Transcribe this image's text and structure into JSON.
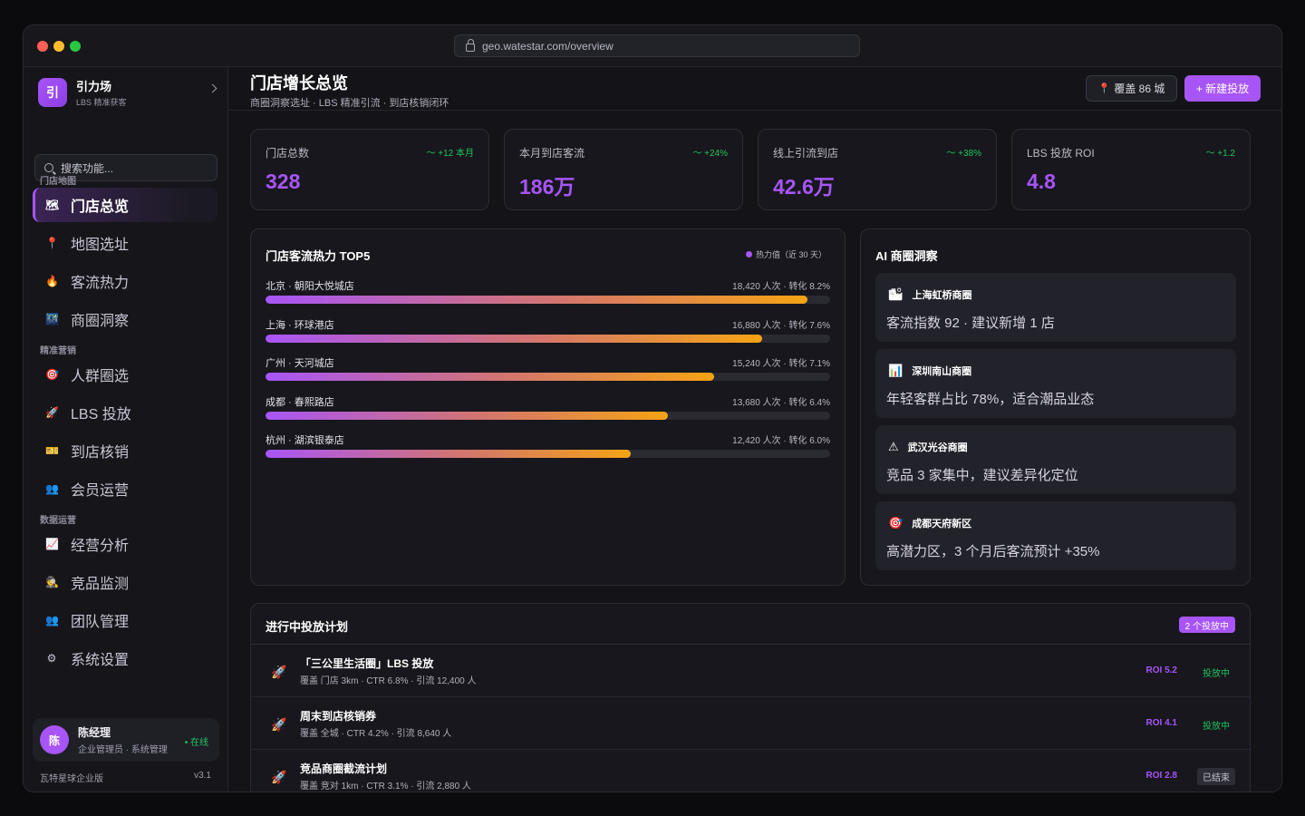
{
  "browser": {
    "url": "geo.watestar.com/overview"
  },
  "sidebar": {
    "brand": {
      "logo": "引",
      "name": "引力场",
      "subtitle": "LBS 精准获客"
    },
    "search_placeholder": "搜索功能...",
    "sections": [
      {
        "label": "门店地图",
        "items": [
          {
            "icon": "🗺",
            "label": "门店总览",
            "active": true
          },
          {
            "icon": "📍",
            "label": "地图选址"
          },
          {
            "icon": "🔥",
            "label": "客流热力"
          },
          {
            "icon": "🌃",
            "label": "商圈洞察"
          }
        ]
      },
      {
        "label": "精准营销",
        "items": [
          {
            "icon": "🎯",
            "label": "人群圈选"
          },
          {
            "icon": "🚀",
            "label": "LBS 投放"
          },
          {
            "icon": "🎫",
            "label": "到店核销"
          },
          {
            "icon": "👥",
            "label": "会员运营"
          }
        ]
      },
      {
        "label": "数据运营",
        "items": [
          {
            "icon": "📈",
            "label": "经营分析"
          },
          {
            "icon": "🕵",
            "label": "竞品监测"
          },
          {
            "icon": "👥",
            "label": "团队管理"
          },
          {
            "icon": "⚙",
            "label": "系统设置"
          }
        ]
      }
    ],
    "user": {
      "avatar": "陈",
      "name": "陈经理",
      "role": "企业管理员 · 系统管理",
      "status": "• 在线"
    },
    "footer": {
      "edition": "瓦特星球企业版",
      "version": "v3.1"
    }
  },
  "header": {
    "title": "门店增长总览",
    "subtitle": "商圈洞察选址 · LBS 精准引流 · 到店核销闭环",
    "cover_label": "覆盖 86 城",
    "new_button": "+ 新建投放"
  },
  "kpis": [
    {
      "label": "门店总数",
      "delta": "+12 本月",
      "value": "328"
    },
    {
      "label": "本月到店客流",
      "delta": "+24%",
      "value": "186万"
    },
    {
      "label": "线上引流到店",
      "delta": "+38%",
      "value": "42.6万"
    },
    {
      "label": "LBS 投放 ROI",
      "delta": "+1.2",
      "value": "4.8"
    }
  ],
  "heat": {
    "title": "门店客流热力 TOP5",
    "legend": "热力值（近 30 天）",
    "colors": {
      "start": "#a855f7",
      "end": "#f5a314"
    },
    "rows": [
      {
        "name": "北京 · 朝阳大悦城店",
        "meta": "18,420 人次 · 转化 8.2%",
        "visitors": 18420
      },
      {
        "name": "上海 · 环球港店",
        "meta": "16,880 人次 · 转化 7.6%",
        "visitors": 16880
      },
      {
        "name": "广州 · 天河城店",
        "meta": "15,240 人次 · 转化 7.1%",
        "visitors": 15240
      },
      {
        "name": "成都 · 春熙路店",
        "meta": "13,680 人次 · 转化 6.4%",
        "visitors": 13680
      },
      {
        "name": "杭州 · 湖滨银泰店",
        "meta": "12,420 人次 · 转化 6.0%",
        "visitors": 12420
      }
    ],
    "scale_max": 19200
  },
  "ai": {
    "title": "AI 商圈洞察",
    "items": [
      {
        "icon": "🏙",
        "name": "上海虹桥商圈",
        "text": "客流指数 92 · 建议新增 1 店"
      },
      {
        "icon": "📊",
        "name": "深圳南山商圈",
        "text": "年轻客群占比 78%，适合潮品业态"
      },
      {
        "icon": "⚠",
        "name": "武汉光谷商圈",
        "text": "竞品 3 家集中，建议差异化定位"
      },
      {
        "icon": "🎯",
        "name": "成都天府新区",
        "text": "高潜力区，3 个月后客流预计 +35%"
      }
    ]
  },
  "plans": {
    "title": "进行中投放计划",
    "badge": "2 个投放中",
    "rows": [
      {
        "icon": "🚀",
        "name": "「三公里生活圈」LBS 投放",
        "meta": "覆盖 门店 3km · CTR 6.8% · 引流 12,400 人",
        "roi": "ROI 5.2",
        "status": "投放中",
        "ended": false
      },
      {
        "icon": "🚀",
        "name": "周末到店核销券",
        "meta": "覆盖 全城 · CTR 4.2% · 引流 8,640 人",
        "roi": "ROI 4.1",
        "status": "投放中",
        "ended": false
      },
      {
        "icon": "🚀",
        "name": "竞品商圈截流计划",
        "meta": "覆盖 竞对 1km · CTR 3.1% · 引流 2,880 人",
        "roi": "ROI 2.8",
        "status": "已结束",
        "ended": true
      }
    ]
  }
}
